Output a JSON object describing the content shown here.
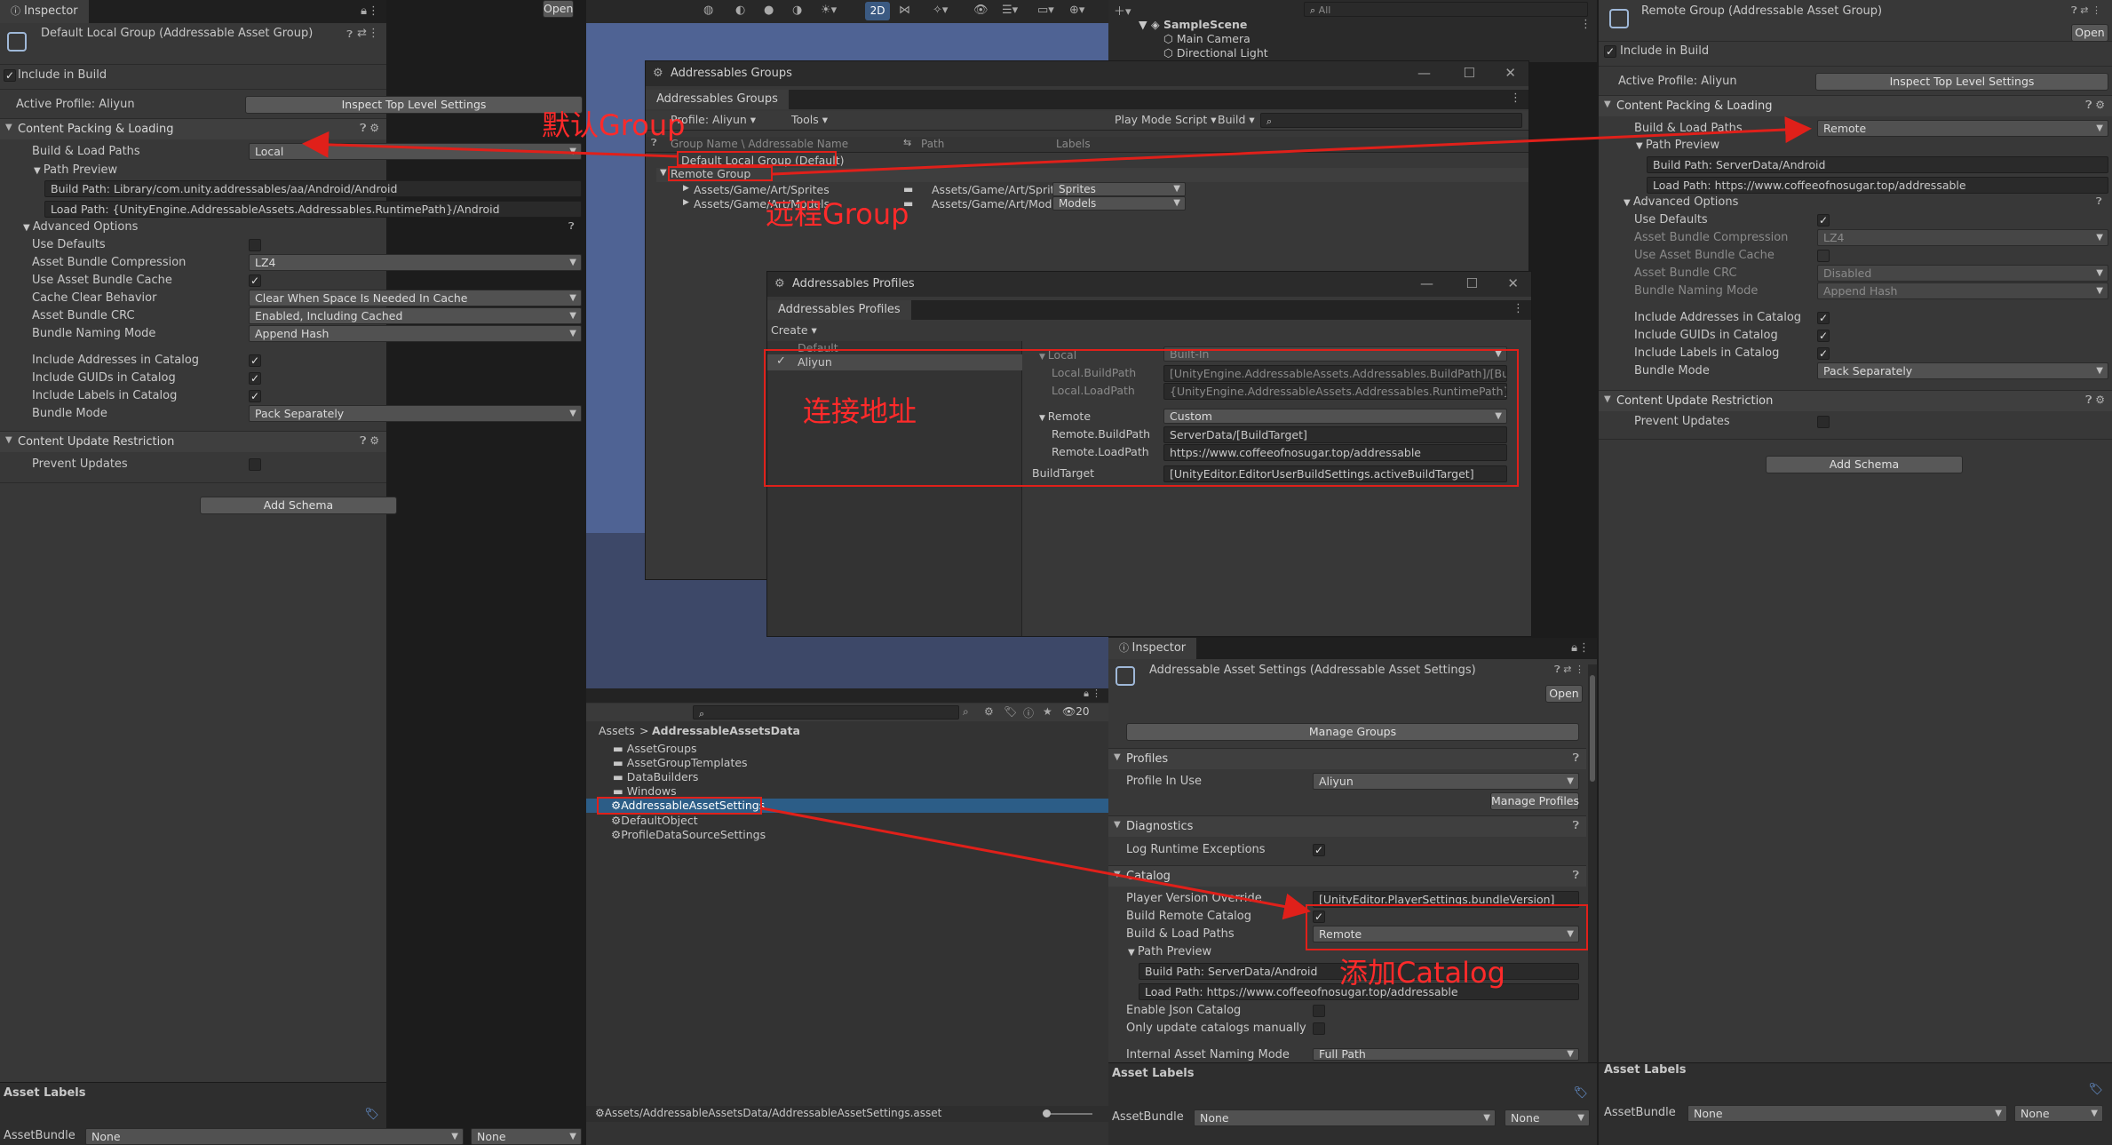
{
  "left_inspector": {
    "tab": "Inspector",
    "title": "Default Local Group (Addressable Asset Group)",
    "open_btn": "Open",
    "include_in_build": "Include in Build",
    "active_profile": "Active Profile: Aliyun",
    "inspect_top": "Inspect Top Level Settings",
    "section_content": "Content Packing & Loading",
    "build_load_paths_label": "Build & Load Paths",
    "build_load_paths_value": "Local",
    "path_preview": "Path Preview",
    "build_path": "Build Path: Library/com.unity.addressables/aa/Android/Android",
    "load_path": "Load Path: {UnityEngine.AddressableAssets.Addressables.RuntimePath}/Android",
    "advanced": "Advanced Options",
    "use_defaults": "Use Defaults",
    "compression_label": "Asset Bundle Compression",
    "compression_value": "LZ4",
    "use_cache_label": "Use Asset Bundle Cache",
    "cache_clear_label": "Cache Clear Behavior",
    "cache_clear_value": "Clear When Space Is Needed In Cache",
    "crc_label": "Asset Bundle CRC",
    "crc_value": "Enabled, Including Cached",
    "naming_label": "Bundle Naming Mode",
    "naming_value": "Append Hash",
    "inc_addresses": "Include Addresses in Catalog",
    "inc_guids": "Include GUIDs in Catalog",
    "inc_labels": "Include Labels in Catalog",
    "bundle_mode_label": "Bundle Mode",
    "bundle_mode_value": "Pack Separately",
    "section_update": "Content Update Restriction",
    "prevent_updates": "Prevent Updates",
    "add_schema": "Add Schema",
    "asset_labels": "Asset Labels",
    "assetbundle": "AssetBundle",
    "none1": "None",
    "none2": "None"
  },
  "annotations": {
    "default_group": "默认Group",
    "remote_group": "远程Group",
    "connection_address": "连接地址",
    "add_catalog": "添加Catalog"
  },
  "toolbar": {
    "mode_2d": "2D",
    "search_placeholder": "All"
  },
  "hierarchy": {
    "scene": "SampleScene",
    "items": [
      "Main Camera",
      "Directional Light"
    ]
  },
  "groups_window": {
    "title": "Addressables Groups",
    "tab": "Addressables Groups",
    "profile": "Profile: Aliyun",
    "tools": "Tools",
    "play_mode": "Play Mode Script",
    "build": "Build",
    "col_name": "Group Name \\ Addressable Name",
    "col_path": "Path",
    "col_labels": "Labels",
    "default_group": "Default Local Group (Default)",
    "remote_group": "Remote Group",
    "rows": [
      {
        "name": "Assets/Game/Art/Sprites",
        "path": "Assets/Game/Art/Sprit",
        "label": "Sprites"
      },
      {
        "name": "Assets/Game/Art/Models",
        "path": "Assets/Game/Art/Mode",
        "label": "Models"
      }
    ]
  },
  "profiles_window": {
    "title": "Addressables Profiles",
    "tab": "Addressables Profiles",
    "create": "Create",
    "profiles": [
      "Default",
      "Aliyun"
    ],
    "local": "Local",
    "local_value": "Built-In",
    "local_build": "Local.BuildPath",
    "local_build_value": "[UnityEngine.AddressableAssets.Addressables.BuildPath]/[BuildTar",
    "local_load": "Local.LoadPath",
    "local_load_value": "{UnityEngine.AddressableAssets.Addressables.RuntimePath}/[Build",
    "remote": "Remote",
    "remote_value": "Custom",
    "remote_build": "Remote.BuildPath",
    "remote_build_value": "ServerData/[BuildTarget]",
    "remote_load": "Remote.LoadPath",
    "remote_load_value": "https://www.coffeeofnosugar.top/addressable",
    "build_target": "BuildTarget",
    "build_target_value": "[UnityEditor.EditorUserBuildSettings.activeBuildTarget]"
  },
  "project": {
    "count": "20",
    "breadcrumb_root": "Assets",
    "breadcrumb_sep": ">",
    "breadcrumb_folder": "AddressableAssetsData",
    "items": [
      "AssetGroups",
      "AssetGroupTemplates",
      "DataBuilders",
      "Windows",
      "AddressableAssetSettings",
      "DefaultObject",
      "ProfileDataSourceSettings"
    ],
    "status_path": "Assets/AddressableAssetsData/AddressableAssetSettings.asset"
  },
  "settings_inspector": {
    "tab": "Inspector",
    "title": "Addressable Asset Settings (Addressable Asset Settings)",
    "open_btn": "Open",
    "manage_groups": "Manage Groups",
    "profiles": "Profiles",
    "profile_in_use": "Profile In Use",
    "profile_value": "Aliyun",
    "manage_profiles": "Manage Profiles",
    "diagnostics": "Diagnostics",
    "log_runtime": "Log Runtime Exceptions",
    "catalog": "Catalog",
    "player_version": "Player Version Override",
    "player_version_value": "[UnityEditor.PlayerSettings.bundleVersion]",
    "build_remote_catalog": "Build Remote Catalog",
    "build_load_paths": "Build & Load Paths",
    "build_load_value": "Remote",
    "path_preview": "Path Preview",
    "build_path": "Build Path: ServerData/Android",
    "load_path": "Load Path: https://www.coffeeofnosugar.top/addressable",
    "enable_json": "Enable Json Catalog",
    "only_update": "Only update catalogs manually",
    "internal_naming": "Internal Asset Naming Mode",
    "internal_naming_value": "Full Path",
    "asset_labels": "Asset Labels",
    "assetbundle": "AssetBundle",
    "none1": "None",
    "none2": "None"
  },
  "right_inspector": {
    "title": "Remote Group (Addressable Asset Group)",
    "open_btn": "Open",
    "include_in_build": "Include in Build",
    "active_profile": "Active Profile: Aliyun",
    "inspect_top": "Inspect Top Level Settings",
    "section_content": "Content Packing & Loading",
    "build_load_paths_label": "Build & Load Paths",
    "build_load_paths_value": "Remote",
    "path_preview": "Path Preview",
    "build_path": "Build Path: ServerData/Android",
    "load_path": "Load Path: https://www.coffeeofnosugar.top/addressable",
    "advanced": "Advanced Options",
    "use_defaults": "Use Defaults",
    "compression_label": "Asset Bundle Compression",
    "compression_value": "LZ4",
    "use_cache_label": "Use Asset Bundle Cache",
    "crc_label": "Asset Bundle CRC",
    "crc_value": "Disabled",
    "naming_label": "Bundle Naming Mode",
    "naming_value": "Append Hash",
    "inc_addresses": "Include Addresses in Catalog",
    "inc_guids": "Include GUIDs in Catalog",
    "inc_labels": "Include Labels in Catalog",
    "bundle_mode_label": "Bundle Mode",
    "bundle_mode_value": "Pack Separately",
    "section_update": "Content Update Restriction",
    "prevent_updates": "Prevent Updates",
    "add_schema": "Add Schema",
    "asset_labels": "Asset Labels",
    "assetbundle": "AssetBundle",
    "none1": "None",
    "none2": "None"
  },
  "colors": {
    "accent_red": "#e0201a",
    "selection": "#2c5d87",
    "scene_blue": "#4f6394"
  }
}
